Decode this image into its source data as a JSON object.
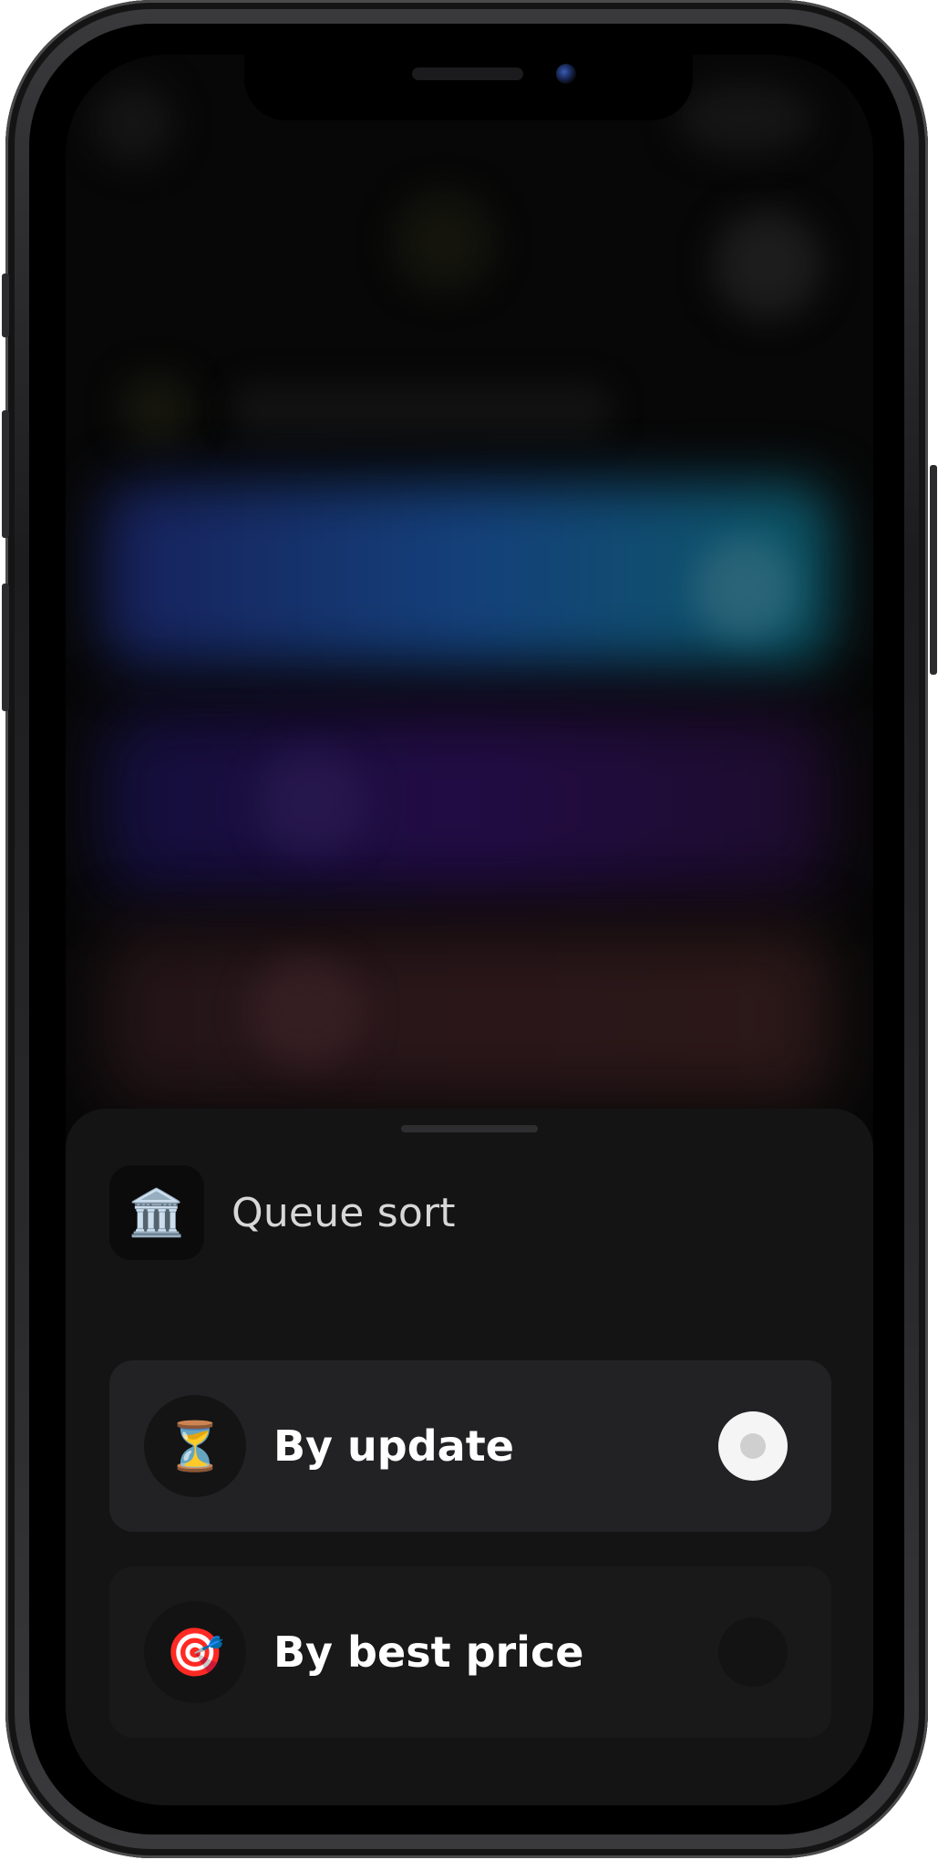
{
  "sheet": {
    "header": {
      "icon": "🏛️",
      "icon_name": "bank-building-icon",
      "title": "Queue sort"
    },
    "options": [
      {
        "icon": "⏳",
        "icon_name": "hourglass-icon",
        "label": "By update",
        "selected": true
      },
      {
        "icon": "🎯",
        "icon_name": "target-dart-icon",
        "label": "By best price",
        "selected": false
      }
    ]
  },
  "colors": {
    "sheet_background": "#141414",
    "selected_option_background": "#222224",
    "radio_selected": "#f5f5f5",
    "label_text": "#ffffff",
    "title_text": "#d7d7d7"
  }
}
